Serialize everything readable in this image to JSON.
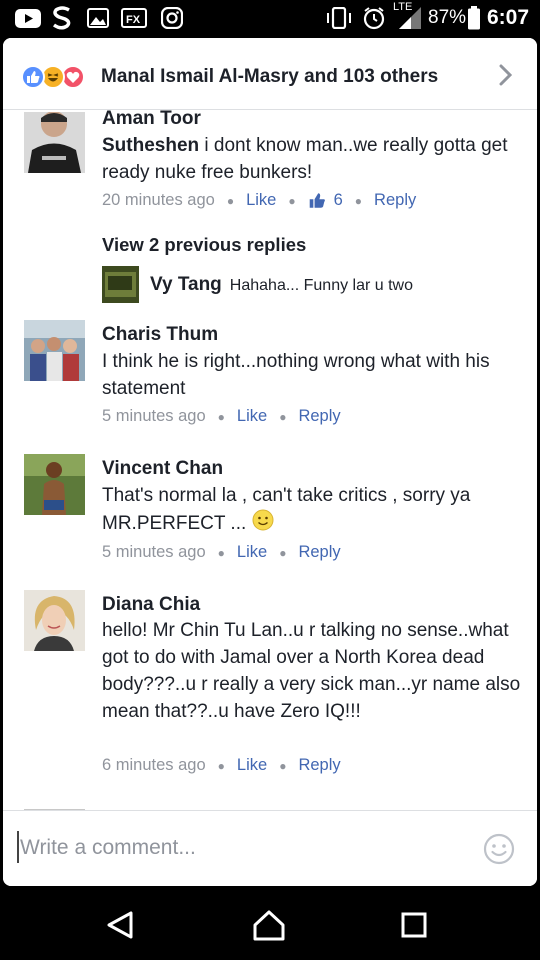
{
  "status_bar": {
    "icons": [
      "youtube-icon",
      "s-app-icon",
      "gallery-icon",
      "fx-app-icon",
      "instagram-icon",
      "vibrate-icon",
      "alarm-icon",
      "lte-signal-icon",
      "battery-icon"
    ],
    "network": "LTE",
    "battery": "87%",
    "time": "6:07"
  },
  "reactions": {
    "types": [
      "like",
      "haha",
      "love"
    ],
    "summary": "Manal Ismail Al-Masry and 103 others"
  },
  "comments": [
    {
      "name": "Aman Toor",
      "mention": "Sutheshen",
      "text": " i dont know man..we really gotta get ready nuke free bunkers!",
      "time": "20 minutes ago",
      "like_label": "Like",
      "like_count": "6",
      "reply_label": "Reply"
    },
    {
      "view_previous": "View 2 previous replies",
      "reply_name": "Vy Tang",
      "reply_text": "Hahaha... Funny lar u two"
    },
    {
      "name": "Charis Thum",
      "text": "I think he is right...nothing wrong what with his statement",
      "time": "5 minutes ago",
      "like_label": "Like",
      "reply_label": "Reply"
    },
    {
      "name": "Vincent Chan",
      "text": "That's normal la , can't take critics , sorry ya MR.PERFECT ...",
      "emoji": "slightly-smiling-emoji",
      "time": "5 minutes ago",
      "like_label": "Like",
      "reply_label": "Reply"
    },
    {
      "name": "Diana Chia",
      "text": "hello! Mr Chin Tu Lan..u r talking no sense..what got to do with Jamal over a North Korea dead body???..u r really a very sick man...yr name also mean that??..u have Zero IQ!!!",
      "time": "6 minutes ago",
      "like_label": "Like",
      "reply_label": "Reply"
    }
  ],
  "composer": {
    "placeholder": "Write a comment..."
  },
  "colors": {
    "link": "#4267b2",
    "meta": "#90949c",
    "text": "#1d2129",
    "like_reaction": "#5890ff",
    "haha_reaction": "#f7b125",
    "love_reaction": "#f25268"
  }
}
